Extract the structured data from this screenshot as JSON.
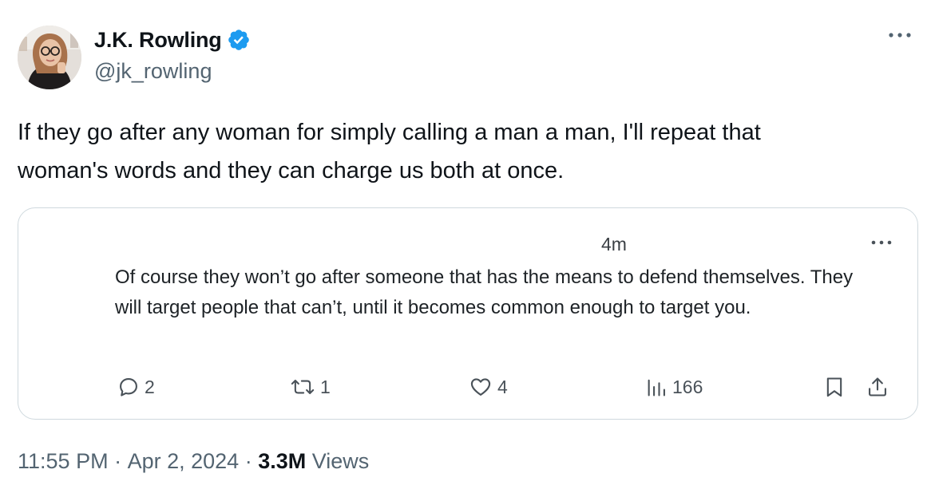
{
  "author": {
    "display_name": "J.K. Rowling",
    "handle": "@jk_rowling",
    "verified": true,
    "verified_color": "#1d9bf0"
  },
  "tweet": {
    "text": "If they go after any woman for simply calling a man a man, I'll repeat that\nwoman's words and they can charge us both at once."
  },
  "quoted_post": {
    "time": "4m",
    "text": "Of course they won’t go after someone that has the means to defend themselves. They will target people that can’t, until it becomes common enough to target you.",
    "replies": "2",
    "reposts": "1",
    "likes": "4",
    "views": "166"
  },
  "meta": {
    "time": "11:55 PM",
    "separator": " · ",
    "date": "Apr 2, 2024",
    "views_count": "3.3M",
    "views_label": "Views"
  },
  "icons": {
    "more": "more-horizontal-icon",
    "reply": "reply-icon",
    "repost": "repost-icon",
    "like": "heart-icon",
    "views": "bar-chart-icon",
    "bookmark": "bookmark-icon",
    "share": "share-icon",
    "verified": "verified-badge-icon"
  }
}
